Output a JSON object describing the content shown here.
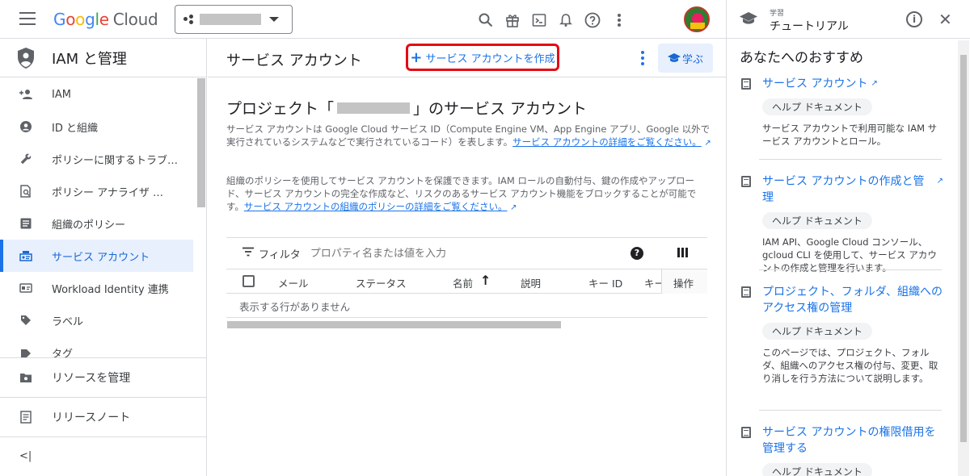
{
  "topbar": {
    "logo": {
      "g": "G",
      "o1": "o",
      "o2": "o",
      "g2": "g",
      "l": "l",
      "e": "e",
      "cloud": "Cloud"
    },
    "icons": [
      "search-icon",
      "gift-icon",
      "terminal-icon",
      "bell-icon",
      "help-icon",
      "more-vert-icon"
    ]
  },
  "sidenav": {
    "title": "IAM と管理",
    "items": [
      {
        "label": "IAM",
        "icon": "person-add-icon"
      },
      {
        "label": "ID と組織",
        "icon": "account-circle-icon"
      },
      {
        "label": "ポリシーに関するトラブ…",
        "icon": "wrench-icon"
      },
      {
        "label": "ポリシー アナライザ …",
        "icon": "policy-analyzer-icon"
      },
      {
        "label": "組織のポリシー",
        "icon": "list-icon"
      },
      {
        "label": "サービス アカウント",
        "icon": "service-account-icon",
        "active": true
      },
      {
        "label": "Workload Identity 連携",
        "icon": "id-card-icon"
      },
      {
        "label": "ラベル",
        "icon": "label-icon"
      },
      {
        "label": "タグ",
        "icon": "tag-icon"
      }
    ],
    "bottom": [
      {
        "label": "リソースを管理",
        "icon": "manage-resources-icon"
      },
      {
        "label": "リリースノート",
        "icon": "release-notes-icon"
      }
    ],
    "collapse": "<|"
  },
  "main": {
    "page_title": "サービス アカウント",
    "create_label": "サービス アカウントを作成",
    "learn_label": "学ぶ",
    "section_title_prefix": "プロジェクト「",
    "section_title_suffix": "」のサービス アカウント",
    "desc1": "サービス アカウントは Google Cloud サービス ID（Compute Engine VM、App Engine アプリ、Google 以外で実行されているシステムなどで実行されているコード）を表します。",
    "desc1_link": "サービス アカウントの詳細をご覧ください。",
    "desc2": "組織のポリシーを使用してサービス アカウントを保護できます。IAM ロールの自動付与、鍵の作成やアップロード、サービス アカウントの完全な作成など、リスクのあるサービス アカウント機能をブロックすることが可能です。",
    "desc2_link": "サービス アカウントの組織のポリシーの詳細をご覧ください。",
    "filter_label": "フィルタ",
    "filter_placeholder": "プロパティ名または値を入力",
    "columns": [
      "メール",
      "ステータス",
      "名前",
      "説明",
      "キー ID",
      "キー",
      "操作"
    ],
    "sort_arrow": "↑",
    "empty_text": "表示する行がありません"
  },
  "panel": {
    "small": "学習",
    "title": "チュートリアル",
    "subtitle": "あなたへのおすすめ",
    "cards": [
      {
        "title": "サービス アカウント",
        "chip": "ヘルプ ドキュメント",
        "desc": "サービス アカウントで利用可能な IAM サービス アカウントとロール。"
      },
      {
        "title": "サービス アカウントの作成と管理",
        "chip": "ヘルプ ドキュメント",
        "desc": "IAM API、Google Cloud コンソール、gcloud CLI を使用して、サービス アカウントの作成と管理を行います。"
      },
      {
        "title": "プロジェクト、フォルダ、組織へのアクセス権の管理",
        "chip": "ヘルプ ドキュメント",
        "desc": "このページでは、プロジェクト、フォルダ、組織へのアクセス権の付与、変更、取り消しを行う方法について説明します。"
      },
      {
        "title": "サービス アカウントの権限借用を管理する",
        "chip": "ヘルプ ドキュメント",
        "desc": ""
      }
    ]
  }
}
